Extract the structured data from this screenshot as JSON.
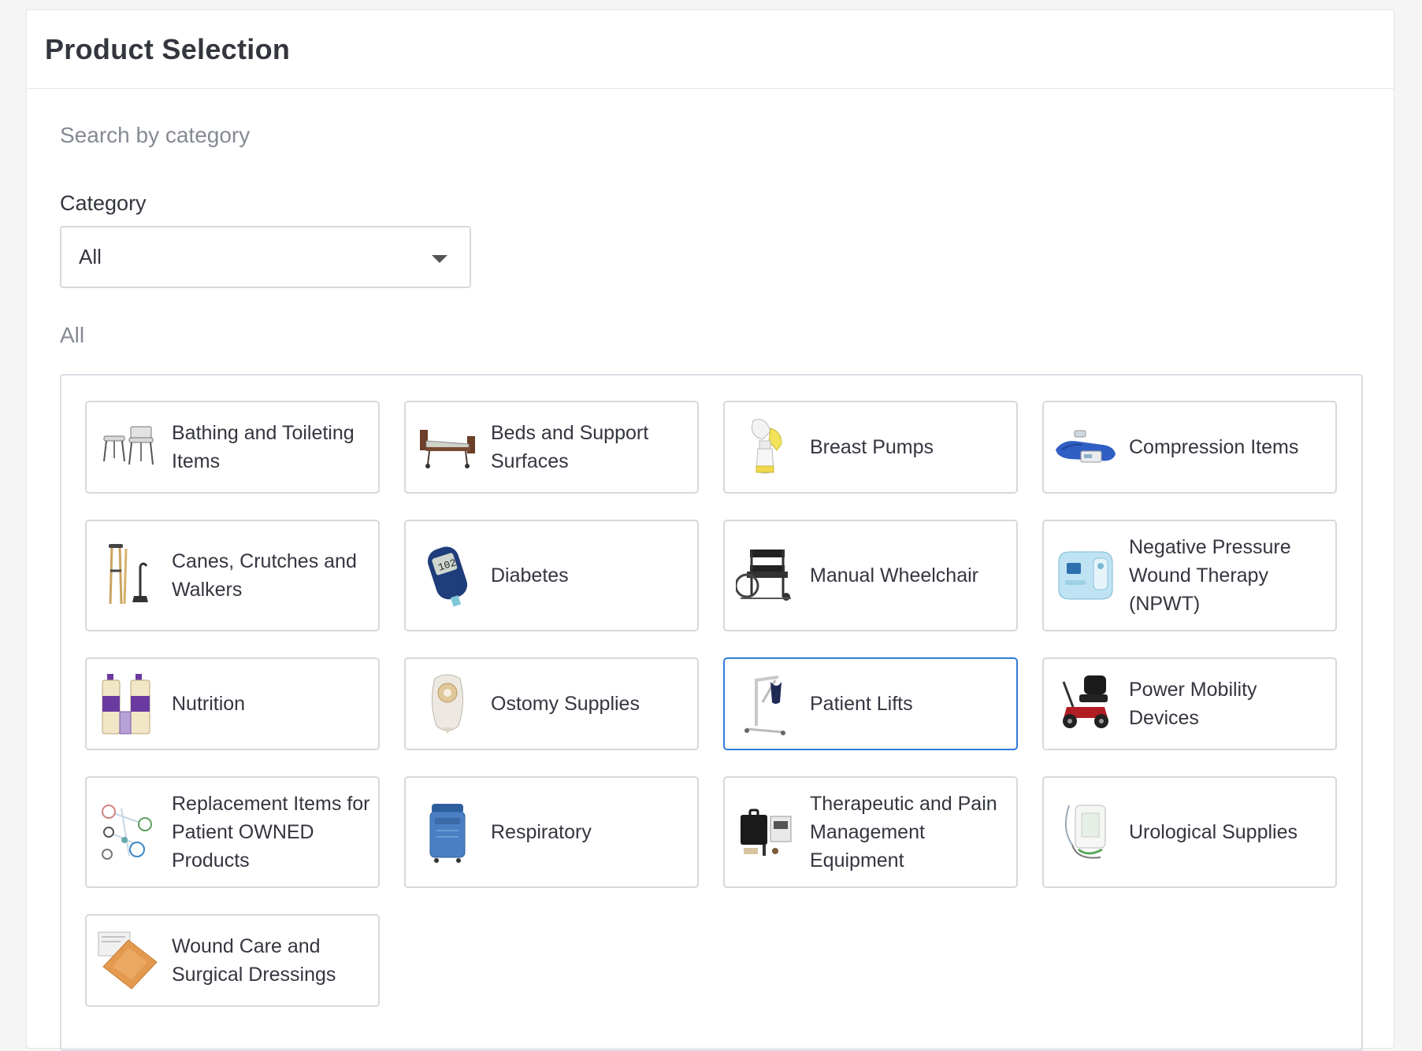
{
  "header": {
    "title": "Product Selection"
  },
  "search": {
    "heading": "Search by category",
    "category_label": "Category",
    "category_value": "All"
  },
  "results": {
    "heading": "All",
    "selected": "Patient Lifts",
    "categories": [
      {
        "label": "Bathing and Toileting Items",
        "icon": "shower-chair-icon"
      },
      {
        "label": "Beds and Support Surfaces",
        "icon": "hospital-bed-icon"
      },
      {
        "label": "Breast Pumps",
        "icon": "breast-pump-icon"
      },
      {
        "label": "Compression Items",
        "icon": "compression-pump-icon"
      },
      {
        "label": "Canes, Crutches and Walkers",
        "icon": "crutches-icon"
      },
      {
        "label": "Diabetes",
        "icon": "glucose-meter-icon"
      },
      {
        "label": "Manual Wheelchair",
        "icon": "wheelchair-icon"
      },
      {
        "label": "Negative Pressure Wound Therapy (NPWT)",
        "icon": "npwt-device-icon"
      },
      {
        "label": "Nutrition",
        "icon": "nutrition-bottles-icon"
      },
      {
        "label": "Ostomy Supplies",
        "icon": "ostomy-bag-icon"
      },
      {
        "label": "Patient Lifts",
        "icon": "patient-lift-icon"
      },
      {
        "label": "Power Mobility Devices",
        "icon": "power-scooter-icon"
      },
      {
        "label": "Replacement Items for Patient OWNED Products",
        "icon": "parts-diagram-icon"
      },
      {
        "label": "Respiratory",
        "icon": "oxygen-concentrator-icon"
      },
      {
        "label": "Therapeutic and Pain Management Equipment",
        "icon": "tens-unit-icon"
      },
      {
        "label": "Urological Supplies",
        "icon": "urine-bag-icon"
      },
      {
        "label": "Wound Care and Surgical Dressings",
        "icon": "wound-dressing-icon"
      }
    ]
  }
}
